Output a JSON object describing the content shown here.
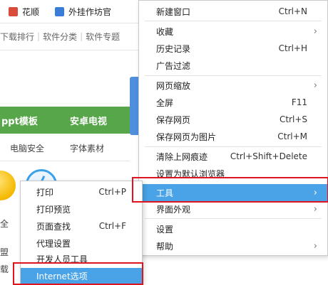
{
  "background": {
    "bookmarks": [
      "花顺",
      "外挂作坊官"
    ],
    "nav_links": [
      "下载排行",
      "软件分类",
      "软件专题"
    ],
    "green_bar": [
      "ppt模板",
      "安卓电视"
    ],
    "categories": [
      "电脑安全",
      "字体素材"
    ],
    "stray_text": [
      "全",
      "盟",
      "载"
    ]
  },
  "main_menu": {
    "items": [
      {
        "label": "新建窗口",
        "shortcut": "Ctrl+N"
      },
      {
        "label": "收藏"
      },
      {
        "label": "历史记录",
        "shortcut": "Ctrl+H"
      },
      {
        "label": "广告过滤"
      },
      {
        "label": "网页缩放"
      },
      {
        "label": "全屏",
        "shortcut": "F11"
      },
      {
        "label": "保存网页",
        "shortcut": "Ctrl+S"
      },
      {
        "label": "保存网页为图片",
        "shortcut": "Ctrl+M"
      },
      {
        "label": "清除上网痕迹",
        "shortcut": "Ctrl+Shift+Delete"
      },
      {
        "label": "设置为默认浏览器"
      },
      {
        "label": "工具"
      },
      {
        "label": "界面外观"
      },
      {
        "label": "设置"
      },
      {
        "label": "帮助"
      }
    ]
  },
  "sub_menu": {
    "items": [
      {
        "label": "打印",
        "shortcut": "Ctrl+P"
      },
      {
        "label": "打印预览"
      },
      {
        "label": "页面查找",
        "shortcut": "Ctrl+F"
      },
      {
        "label": "代理设置"
      },
      {
        "label": "开发人员工具"
      },
      {
        "label": "Internet选项"
      }
    ]
  },
  "colors": {
    "highlight": "#4aa3e6",
    "annotation_box": "#e0141e",
    "green_bar": "#58a64a"
  }
}
